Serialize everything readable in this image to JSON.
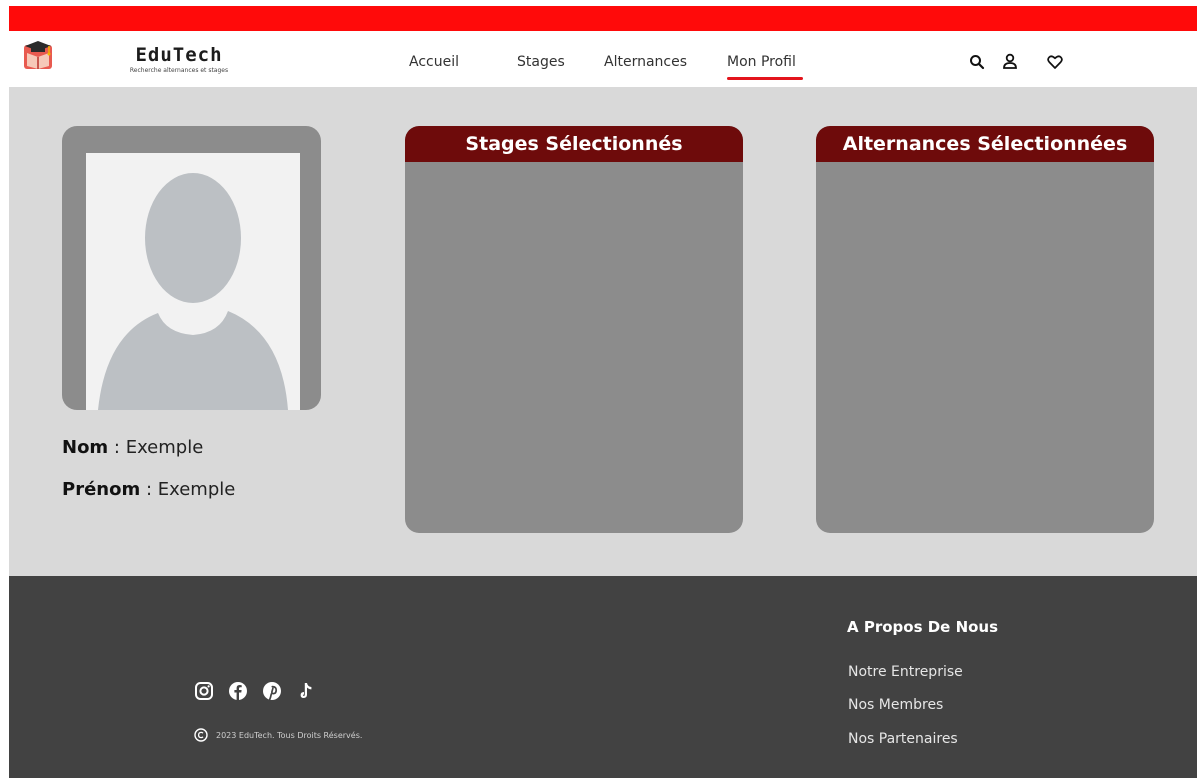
{
  "brand": {
    "name": "EduTech",
    "tagline": "Recherche alternances et stages",
    "logo_icon": "graduation-book-icon",
    "accent_color": "#ff0a0a"
  },
  "nav": {
    "items": [
      {
        "label": "Accueil"
      },
      {
        "label": "Stages"
      },
      {
        "label": "Alternances"
      },
      {
        "label": "Mon Profil",
        "active": true
      }
    ],
    "active_underline_color": "#e3141c"
  },
  "header_icons": [
    "search-icon",
    "user-icon",
    "heart-icon"
  ],
  "profile": {
    "avatar_icon": "user-placeholder-icon",
    "fields": [
      {
        "key": "Nom",
        "sep": " : ",
        "value": "Exemple"
      },
      {
        "key": "Prénom",
        "sep": " : ",
        "value": "Exemple"
      }
    ]
  },
  "panels": [
    {
      "title": "Stages Sélectionnés",
      "header_color": "#6e0b0b"
    },
    {
      "title": "Alternances Sélectionnées",
      "header_color": "#6e0b0b"
    }
  ],
  "footer": {
    "social_icons": [
      "instagram-icon",
      "facebook-icon",
      "pinterest-icon",
      "tiktok-icon"
    ],
    "copyright_icon": "copyright-icon",
    "copyright": "2023 EduTech. Tous Droits Réservés.",
    "about": {
      "heading": "A Propos De Nous",
      "links": [
        "Notre Entreprise",
        "Nos Membres",
        "Nos Partenaires"
      ]
    }
  }
}
